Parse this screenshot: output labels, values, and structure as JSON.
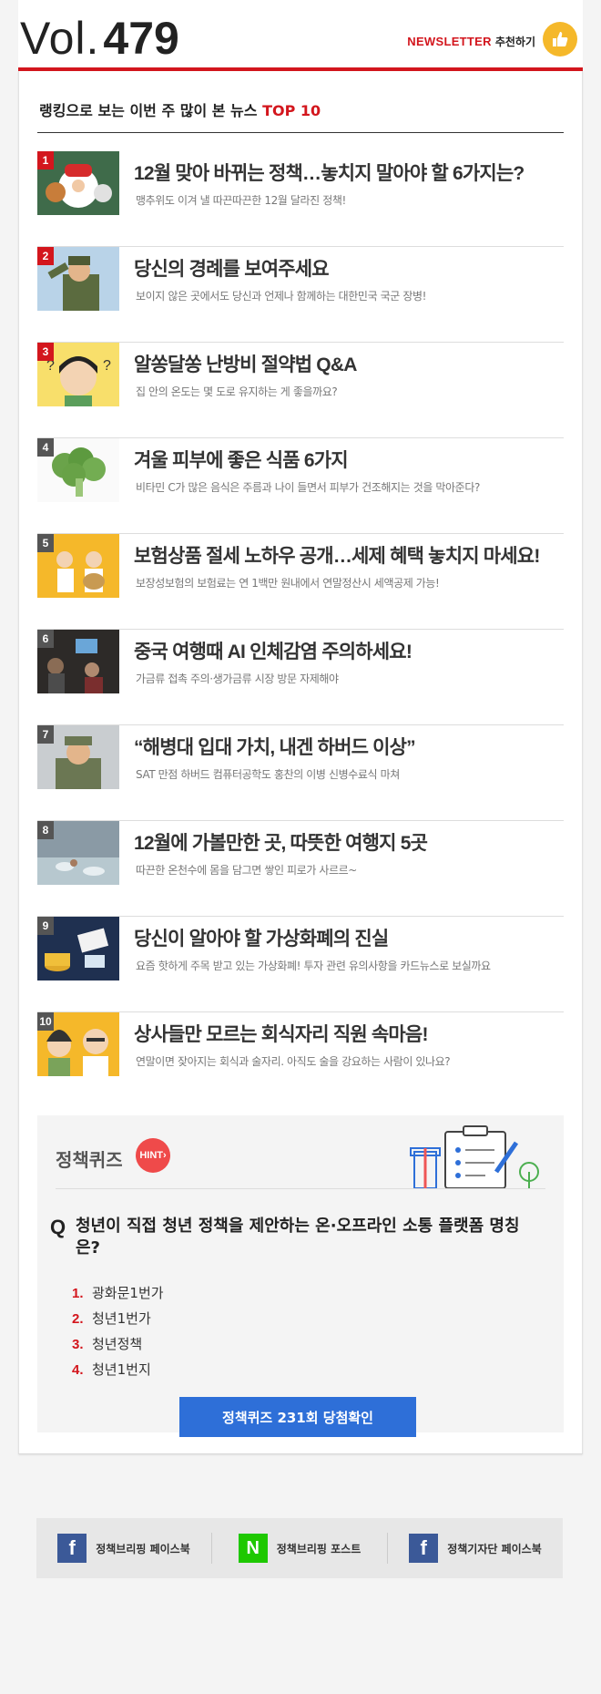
{
  "header": {
    "vol_prefix": "Vol.",
    "vol_number": "479",
    "newsletter_en": "NEWSLETTER",
    "newsletter_ko": "추천하기",
    "thumb_icon": "thumbs-up-icon"
  },
  "ranking": {
    "title_prefix": "랭킹으로 보는 이번 주 많이 본 뉴스",
    "title_accent": "TOP 10",
    "items": [
      {
        "rank": "1",
        "title": "12월 맞아 바뀌는 정책…놓치지 말아야 할 6가지는?",
        "subtitle": "맹추위도 이겨 낼 따끈따끈한 12월 달라진 정책!"
      },
      {
        "rank": "2",
        "title": "당신의 경례를 보여주세요",
        "subtitle": "보이지 않은 곳에서도 당신과 언제나 함께하는 대한민국 국군 장병!"
      },
      {
        "rank": "3",
        "title": "알쏭달쏭 난방비 절약법 Q&A",
        "subtitle": "집 안의 온도는 몇 도로 유지하는 게 좋을까요?"
      },
      {
        "rank": "4",
        "title": "겨울 피부에 좋은 식품 6가지",
        "subtitle": "비타민 C가 많은 음식은 주름과 나이 들면서 피부가 건조해지는 것을 막아준다?"
      },
      {
        "rank": "5",
        "title": "보험상품 절세 노하우 공개…세제 혜택 놓치지 마세요!",
        "subtitle": "보장성보험의 보험료는 연 1백만 원내에서 연말정산시 세액공제 가능!"
      },
      {
        "rank": "6",
        "title": "중국 여행때 AI 인체감염 주의하세요!",
        "subtitle": "가금류 접촉 주의·생가금류 시장 방문 자제해야"
      },
      {
        "rank": "7",
        "title": "“해병대 입대 가치, 내겐 하버드 이상”",
        "subtitle": "SAT 만점 하버드 컴퓨터공학도 홍찬의 이병 신병수료식 마쳐"
      },
      {
        "rank": "8",
        "title": "12월에 가볼만한 곳, 따뜻한 여행지 5곳",
        "subtitle": "따끈한 온천수에 몸을 담그면 쌓인 피로가 사르르~"
      },
      {
        "rank": "9",
        "title": "당신이 알아야 할 가상화폐의 진실",
        "subtitle": "요즘 핫하게 주목 받고 있는 가상화폐! 투자 관련 유의사항을 카드뉴스로 보실까요"
      },
      {
        "rank": "10",
        "title": "상사들만 모르는 회식자리 직원 속마음!",
        "subtitle": "연말이면 잦아지는 회식과 술자리. 아직도 술을 강요하는 사람이 있나요?"
      }
    ]
  },
  "quiz": {
    "label": "정책퀴즈",
    "hint": "HINT",
    "q_mark": "Q",
    "question": "청년이 직접 청년 정책을 제안하는 온·오프라인 소통 플랫폼 명칭은?",
    "options": [
      {
        "num": "1.",
        "text": "광화문1번가"
      },
      {
        "num": "2.",
        "text": "청년1번가"
      },
      {
        "num": "3.",
        "text": "청년정책"
      },
      {
        "num": "4.",
        "text": "청년1번지"
      }
    ],
    "button": "정책퀴즈 231회 당첨확인"
  },
  "footer": {
    "links": [
      {
        "label": "정책브리핑 페이스북",
        "icon": "facebook-icon",
        "glyph": "f"
      },
      {
        "label": "정책브리핑 포스트",
        "icon": "naver-icon",
        "glyph": "N"
      },
      {
        "label": "정책기자단 페이스북",
        "icon": "facebook-icon",
        "glyph": "f"
      }
    ]
  },
  "colors": {
    "accent_red": "#d3161d",
    "button_blue": "#2e6fd8",
    "hint_red": "#ef4a4a",
    "facebook_blue": "#3b5998",
    "naver_green": "#1ec800"
  }
}
